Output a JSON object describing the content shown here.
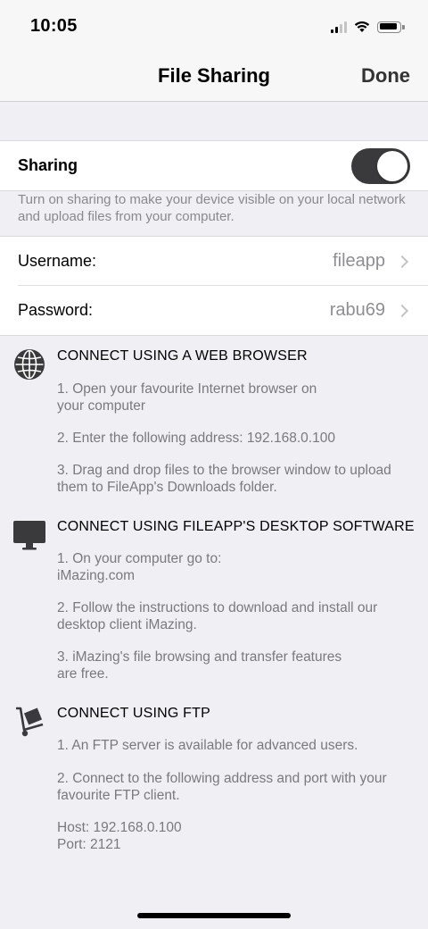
{
  "status_bar": {
    "time": "10:05"
  },
  "nav": {
    "title": "File Sharing",
    "done_label": "Done"
  },
  "sharing": {
    "label": "Sharing",
    "enabled": true,
    "footnote": "Turn on sharing to make your device visible on your local network and upload files from your computer."
  },
  "credentials": {
    "username_label": "Username:",
    "username_value": "fileapp",
    "password_label": "Password:",
    "password_value": "rabu69"
  },
  "sections": {
    "web": {
      "icon": "globe-icon",
      "title": "CONNECT USING A WEB BROWSER",
      "steps": [
        "1. Open your favourite Internet browser on\nyour computer",
        "2. Enter the following address: 192.168.0.100",
        "3. Drag and drop files to the browser window to upload\nthem to FileApp's Downloads folder."
      ]
    },
    "desktop": {
      "icon": "desktop-monitor-icon",
      "title": "CONNECT USING FILEAPP'S DESKTOP SOFTWARE",
      "steps": [
        "1. On your computer go to:\niMazing.com",
        "2. Follow the instructions to download and install our\ndesktop client iMazing.",
        "3. iMazing's file browsing and transfer features\nare free."
      ]
    },
    "ftp": {
      "icon": "hand-truck-icon",
      "title": "CONNECT USING FTP",
      "steps": [
        "1. An FTP server is available for advanced users.",
        "2. Connect to the following address and port with your\nfavourite FTP client.",
        "Host: 192.168.0.100\nPort:  2121"
      ]
    }
  }
}
